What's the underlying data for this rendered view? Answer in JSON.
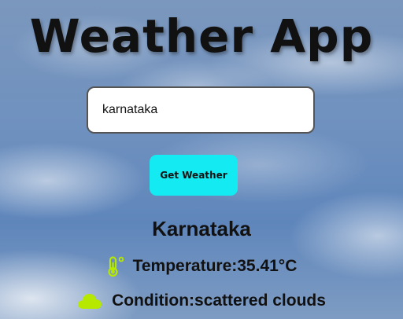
{
  "app": {
    "title": "Weather App"
  },
  "search": {
    "value": "karnataka",
    "button_label": "Get Weather"
  },
  "result": {
    "city": "Karnataka",
    "temperature_text": "Temperature:35.41°C",
    "condition_text": "Condition:scattered clouds"
  },
  "icons": {
    "temperature": "thermometer-icon",
    "condition": "cloud-icon"
  },
  "colors": {
    "button": "#14eaf1",
    "icon_accent": "#b6e800"
  }
}
